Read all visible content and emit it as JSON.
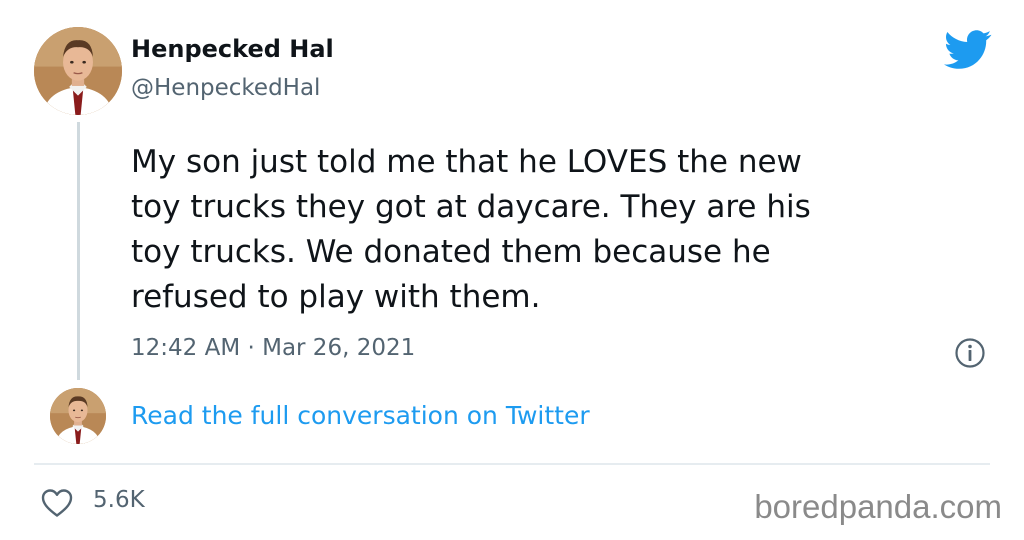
{
  "tweet": {
    "author": {
      "display_name": "Henpecked Hal",
      "handle": "@HenpeckedHal",
      "avatar": "profile-photo"
    },
    "text_lines": [
      "My son just told me that he LOVES the new",
      "toy trucks they got at daycare. They are his",
      "toy trucks. We donated them because he",
      "refused to play with them."
    ],
    "timestamp": "12:42 AM · Mar 26, 2021",
    "read_more_label": "Read the full conversation on Twitter",
    "likes": "5.6K"
  },
  "icons": {
    "brand": "twitter-bird-icon",
    "info": "info-icon",
    "like": "heart-icon"
  },
  "colors": {
    "twitter_blue": "#1d9bf0",
    "text_primary": "#0f1419",
    "text_secondary": "#536471",
    "divider": "#e6ecf0",
    "watermark": "#8a8a8a"
  },
  "watermark": "boredpanda.com"
}
